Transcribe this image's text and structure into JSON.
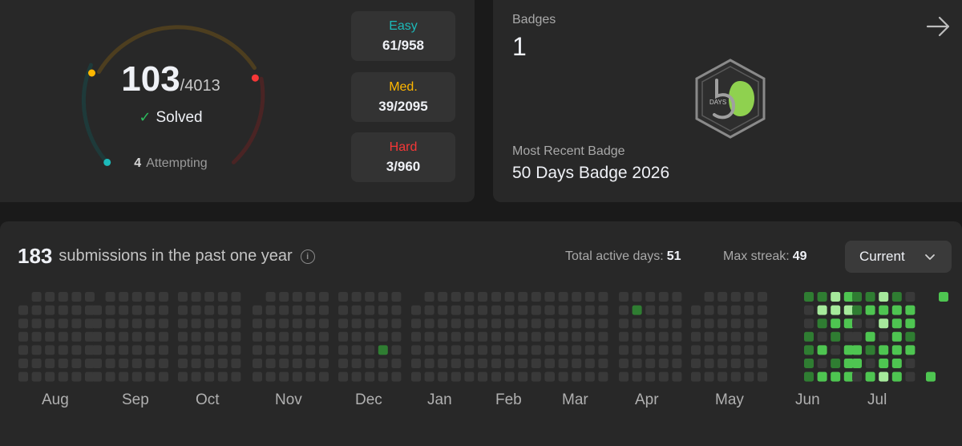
{
  "progress": {
    "solved": "103",
    "total": "/4013",
    "solved_label": "Solved",
    "attempting_count": "4",
    "attempting_label": "Attempting",
    "ring_fraction_solved": 0.026,
    "difficulties": [
      {
        "label": "Easy",
        "value": "61/958",
        "color": "#1cbaba"
      },
      {
        "label": "Med.",
        "value": "39/2095",
        "color": "#ffb700"
      },
      {
        "label": "Hard",
        "value": "3/960",
        "color": "#f63737"
      }
    ]
  },
  "badges": {
    "title": "Badges",
    "count": "1",
    "recent_label": "Most Recent Badge",
    "recent_name": "50 Days Badge 2026",
    "badge_text": "DAYS",
    "badge_number": "50"
  },
  "calendar": {
    "submissions": "183",
    "submissions_text": "submissions in the past one year",
    "active_days_label": "Total active days:",
    "active_days": "51",
    "max_streak_label": "Max streak:",
    "max_streak": "49",
    "year_selector": "Current",
    "months": [
      "Aug",
      "Sep",
      "Oct",
      "Nov",
      "Dec",
      "Jan",
      "Feb",
      "Mar",
      "Apr",
      "May",
      "Jun",
      "Jul"
    ],
    "colors": {
      "empty": "#393939",
      "l1": "#0e4429",
      "l2": "#2f7d32",
      "l3": "#4ec551",
      "l4": "#a6ea9c"
    }
  }
}
